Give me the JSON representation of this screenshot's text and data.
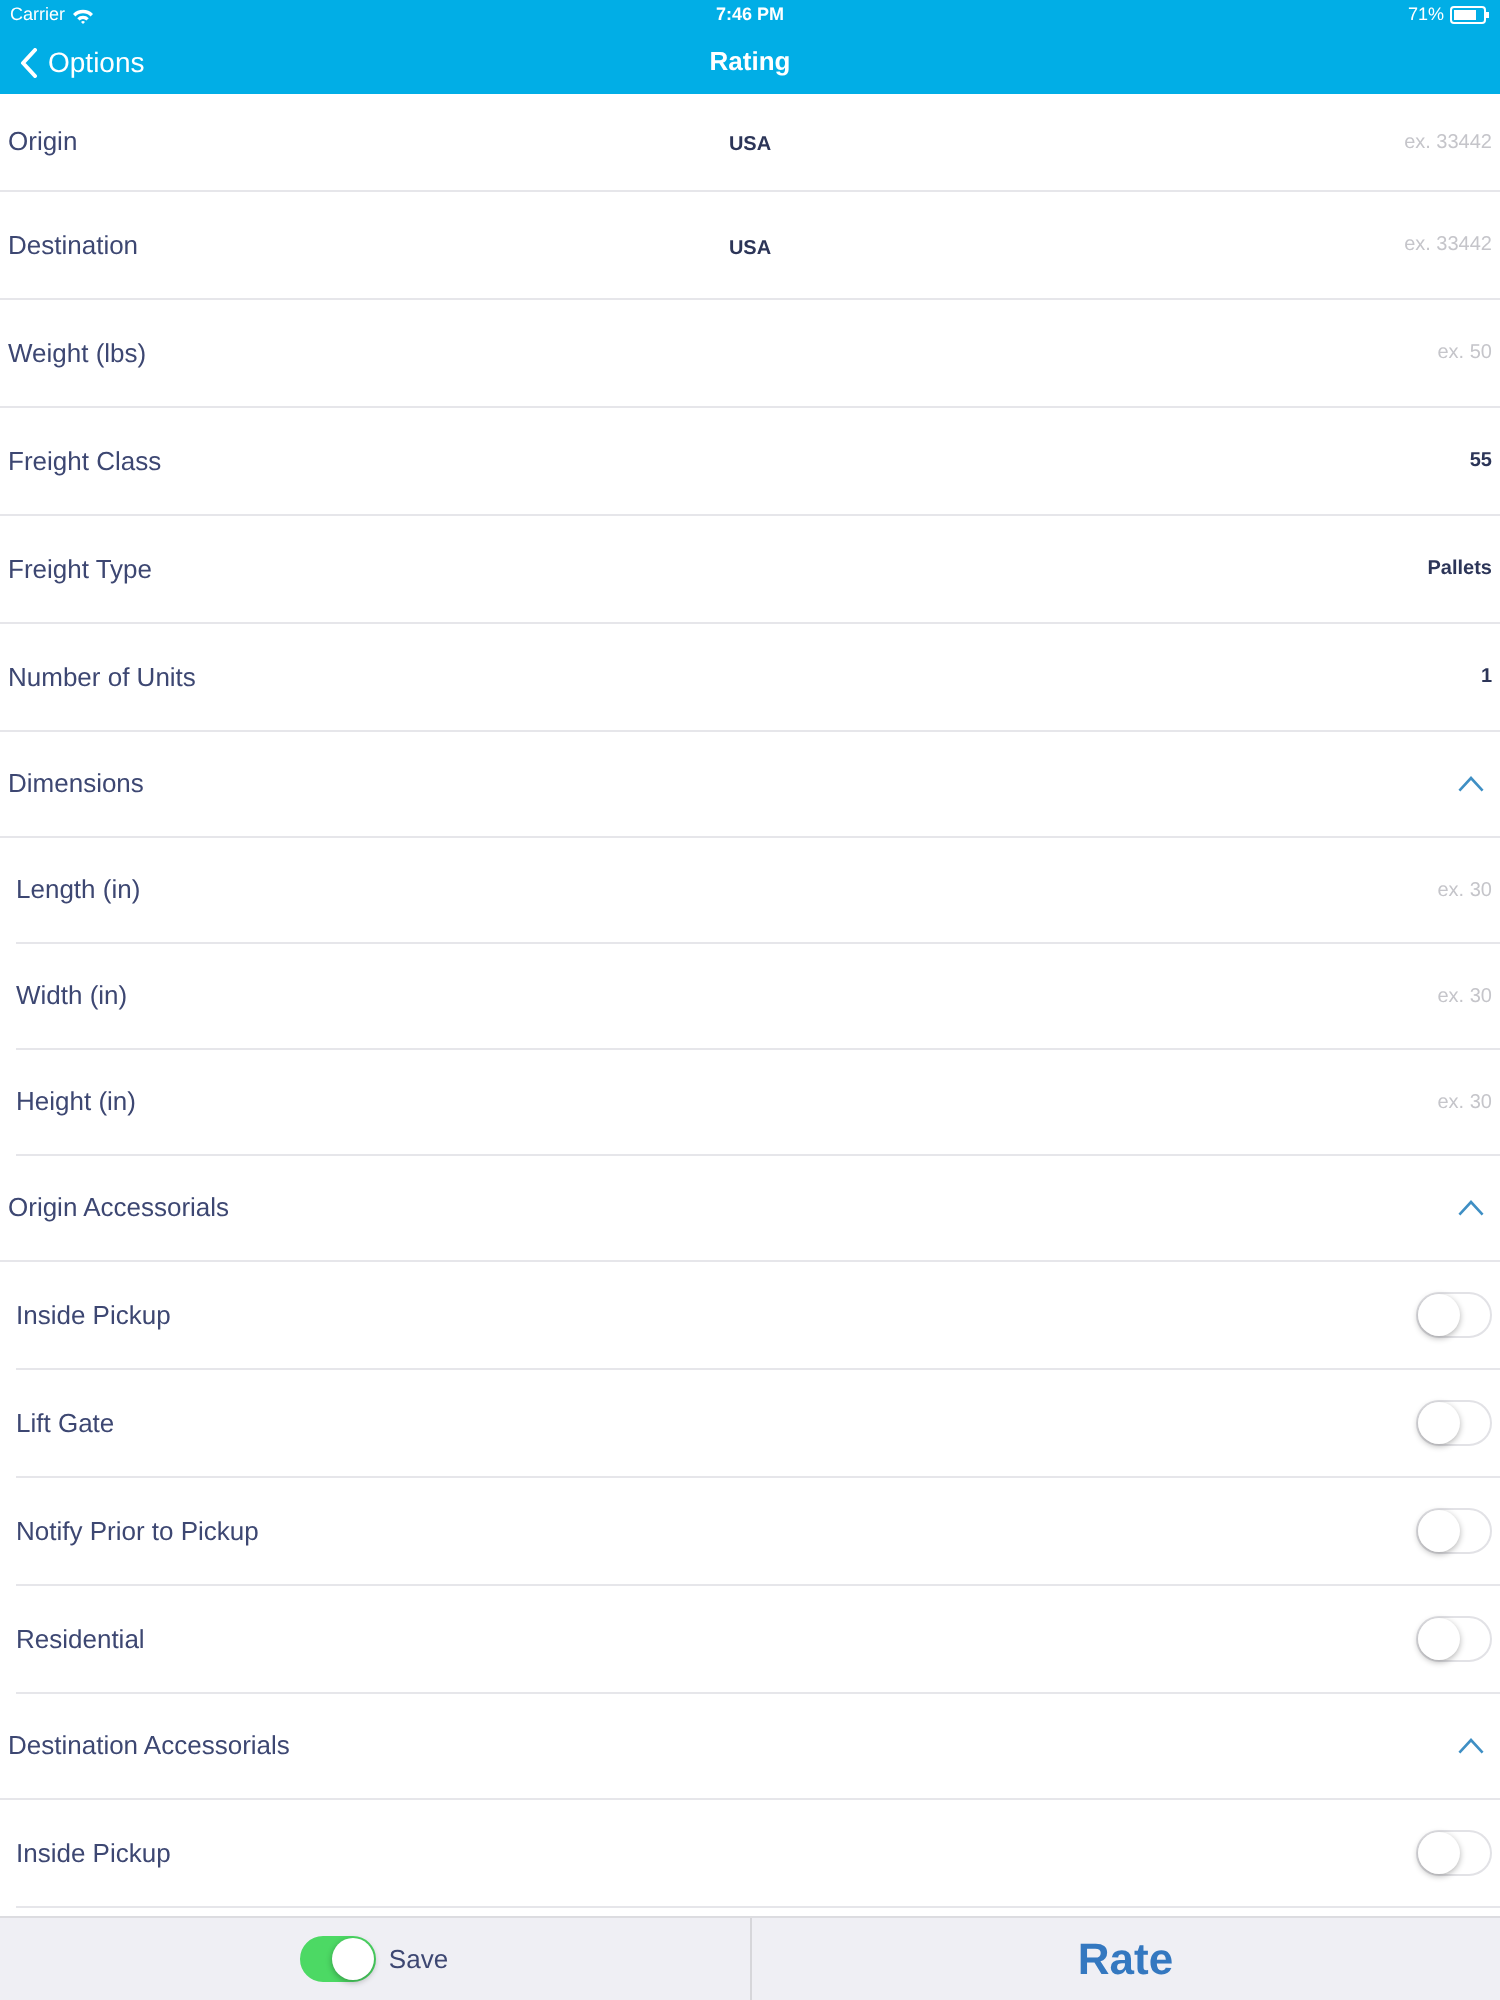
{
  "status_bar": {
    "carrier": "Carrier",
    "time": "7:46 PM",
    "battery": "71%"
  },
  "nav_bar": {
    "back_label": "Options",
    "title": "Rating"
  },
  "form": {
    "rows": [
      {
        "kind": "field",
        "label": "Origin",
        "country": "USA",
        "placeholder": "ex. 33442"
      },
      {
        "kind": "field",
        "label": "Destination",
        "country": "USA",
        "placeholder": "ex. 33442"
      },
      {
        "kind": "field",
        "label": "Weight (lbs)",
        "placeholder": "ex. 50"
      },
      {
        "kind": "field",
        "label": "Freight Class",
        "value": "55"
      },
      {
        "kind": "field",
        "label": "Freight Type",
        "value": "Pallets"
      },
      {
        "kind": "field",
        "label": "Number of Units",
        "value": "1"
      },
      {
        "kind": "section",
        "label": "Dimensions",
        "expanded": true,
        "children": [
          {
            "kind": "field",
            "label": "Length (in)",
            "placeholder": "ex. 30"
          },
          {
            "kind": "field",
            "label": "Width (in)",
            "placeholder": "ex. 30"
          },
          {
            "kind": "field",
            "label": "Height (in)",
            "placeholder": "ex. 30"
          }
        ]
      },
      {
        "kind": "section",
        "label": "Origin Accessorials",
        "expanded": true,
        "children": [
          {
            "kind": "toggle",
            "label": "Inside Pickup",
            "on": false
          },
          {
            "kind": "toggle",
            "label": "Lift Gate",
            "on": false
          },
          {
            "kind": "toggle",
            "label": "Notify Prior to Pickup",
            "on": false
          },
          {
            "kind": "toggle",
            "label": "Residential",
            "on": false
          }
        ]
      },
      {
        "kind": "section",
        "label": "Destination Accessorials",
        "expanded": true,
        "children": [
          {
            "kind": "toggle",
            "label": "Inside Pickup",
            "on": false
          }
        ]
      }
    ]
  },
  "bottom_bar": {
    "save": {
      "label": "Save",
      "on": true
    },
    "rate_button": {
      "label": "Rate"
    }
  }
}
